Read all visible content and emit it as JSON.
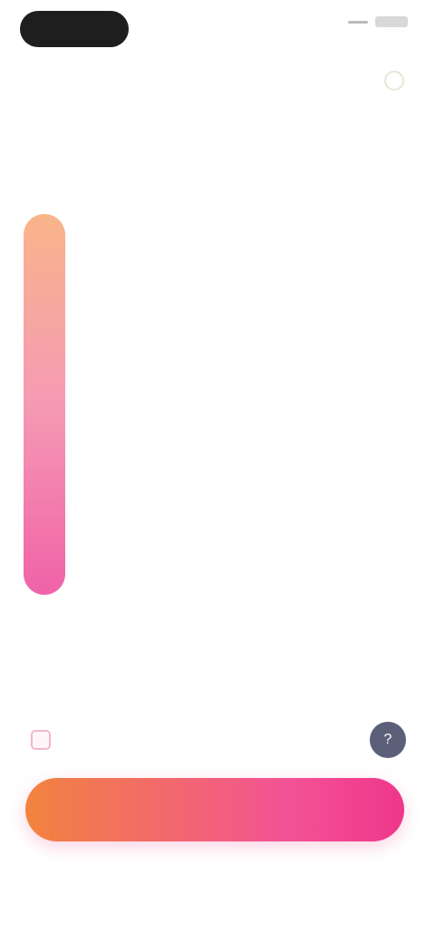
{
  "status": {
    "time": "",
    "right_text": ""
  },
  "title": {
    "line1": "",
    "line2": ""
  },
  "steps": [
    {
      "title": "",
      "desc": ""
    },
    {
      "title": "",
      "desc": ""
    },
    {
      "title": "",
      "desc": ""
    }
  ],
  "note": "",
  "checkbox": {
    "label": "",
    "checked": false
  },
  "cta": {
    "label": ""
  },
  "footer": {
    "left": "",
    "right": "",
    "note": ""
  },
  "colors": {
    "timeline_top": "#f9b48a",
    "timeline_bottom": "#f062a7",
    "cta_start": "#f2833e",
    "cta_end": "#f0368a",
    "help_circle": "#5b5f7a"
  },
  "icons": {
    "top_right": "circle-outline-icon",
    "help": "help-circle-icon"
  }
}
